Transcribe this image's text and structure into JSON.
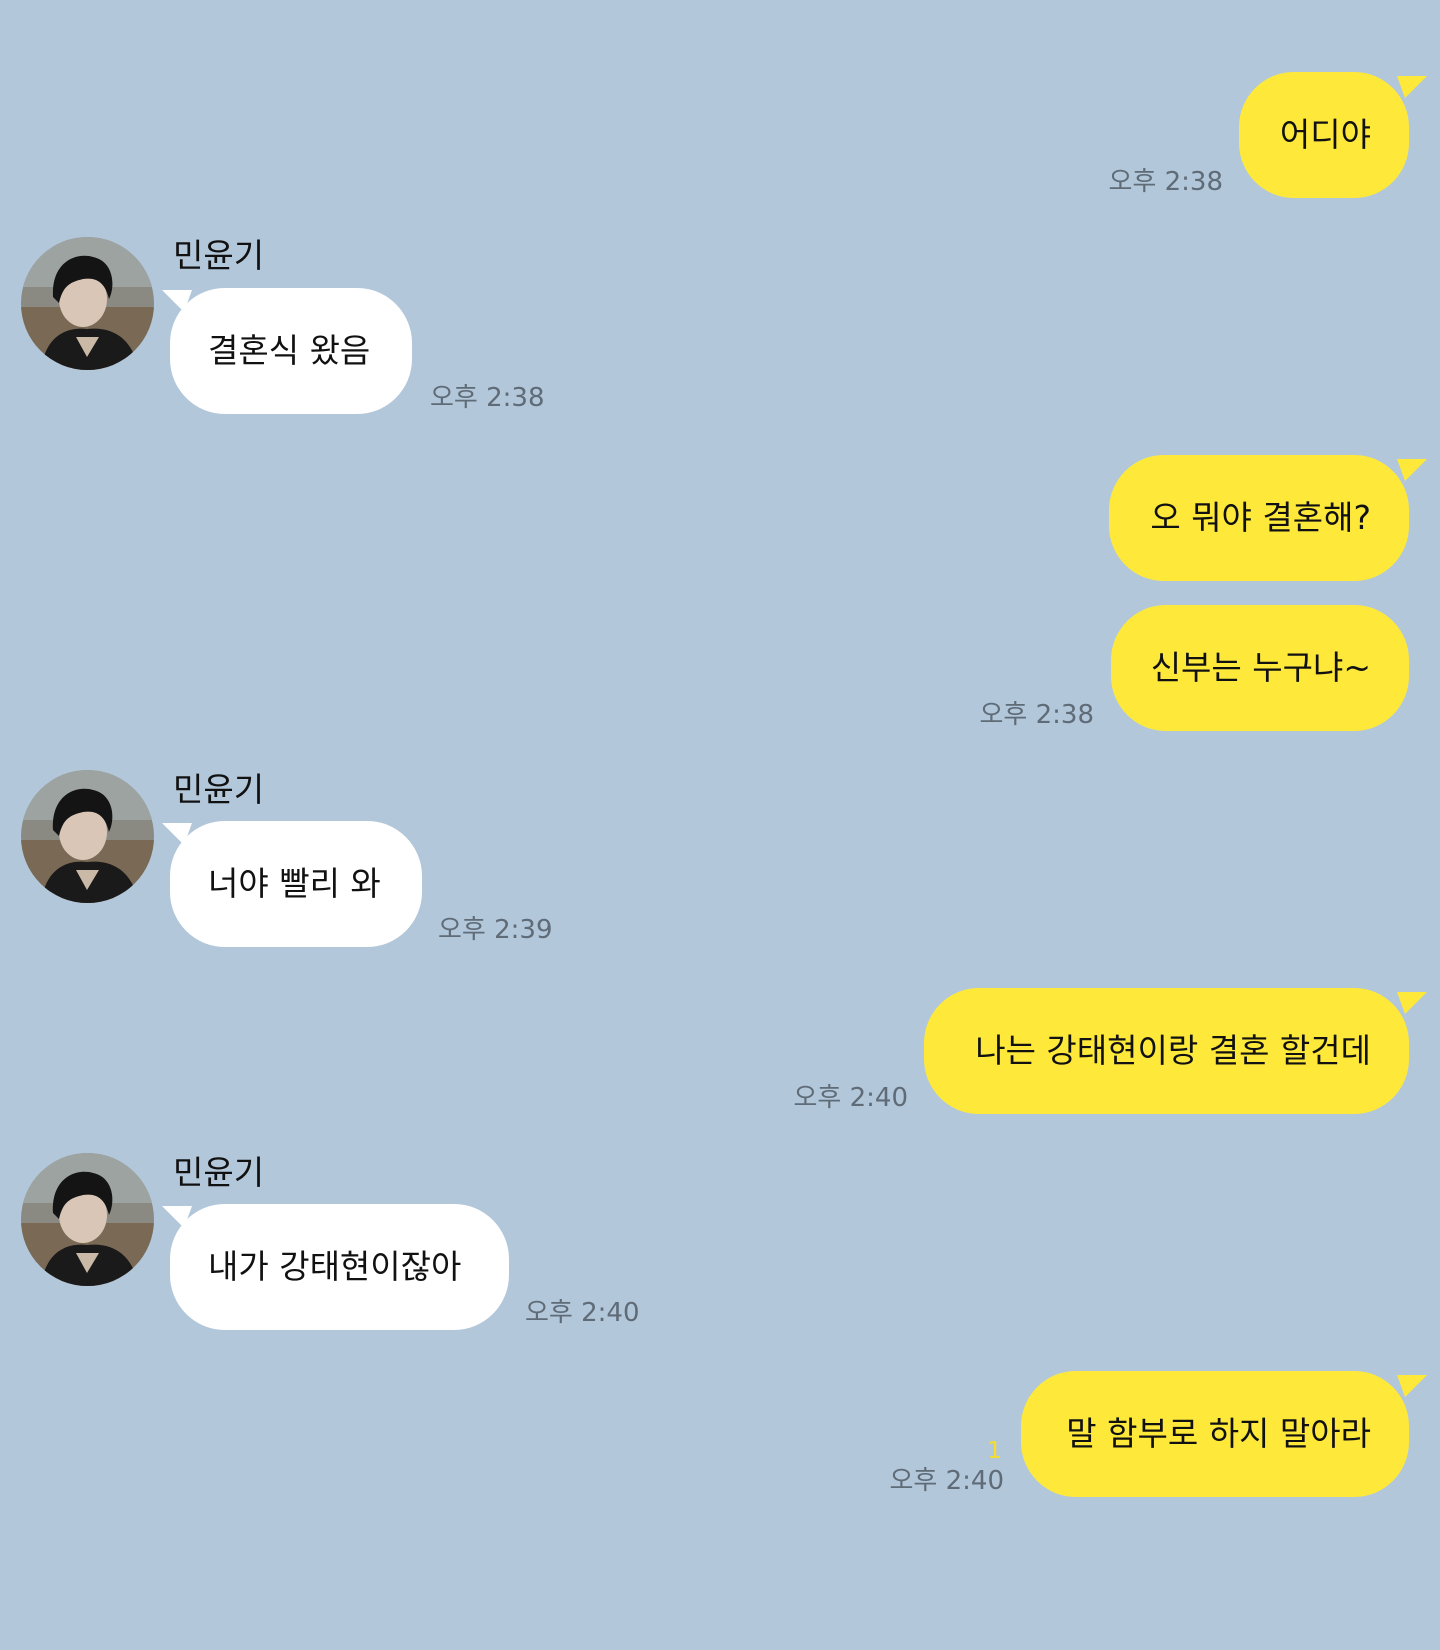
{
  "colors": {
    "background": "#b2c7da",
    "my_bubble": "#fee93b",
    "their_bubble": "#ffffff",
    "timestamp": "#5f6b77",
    "unread_count": "#f5de2b"
  },
  "contact": {
    "name": "민윤기",
    "avatar": "profile-photo"
  },
  "messages": [
    {
      "from": "me",
      "text": "어디야",
      "time": "오후 2:38"
    },
    {
      "from": "them",
      "sender": "민윤기",
      "text": "결혼식 왔음",
      "time": "오후 2:38"
    },
    {
      "from": "me",
      "text": "오 뭐야 결혼해?"
    },
    {
      "from": "me",
      "text": "신부는 누구냐~",
      "time": "오후 2:38"
    },
    {
      "from": "them",
      "sender": "민윤기",
      "text": "너야 빨리 와",
      "time": "오후 2:39"
    },
    {
      "from": "me",
      "text": "나는 강태현이랑 결혼 할건데",
      "time": "오후 2:40"
    },
    {
      "from": "them",
      "sender": "민윤기",
      "text": "내가 강태현이잖아",
      "time": "오후 2:40"
    },
    {
      "from": "me",
      "text": "말 함부로 하지 말아라",
      "time": "오후 2:40",
      "unread": "1"
    }
  ]
}
